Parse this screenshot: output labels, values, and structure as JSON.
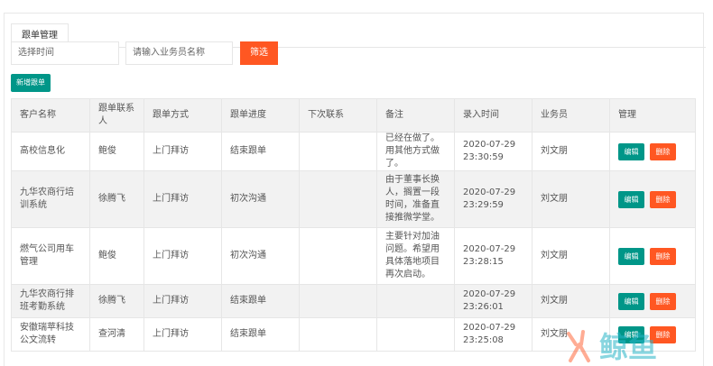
{
  "tabs": [
    {
      "label": "跟单管理"
    }
  ],
  "filters": {
    "time_placeholder": "选择时间",
    "name_placeholder": "请输入业务员名称",
    "filter_label": "筛选"
  },
  "toolbar": {
    "add_label": "新增跟单"
  },
  "table": {
    "columns": [
      "客户名称",
      "跟单联系人",
      "跟单方式",
      "跟单进度",
      "下次联系",
      "备注",
      "录入时间",
      "业务员",
      "管理"
    ],
    "rows": [
      {
        "customer": "高校信息化",
        "contact": "鲍俊",
        "method": "上门拜访",
        "progress": "结束跟单",
        "next": "",
        "note": "已经在做了。用其他方式做了。",
        "date": "2020-07-29",
        "time": "23:30:59",
        "sales": "刘文朋"
      },
      {
        "customer": "九华农商行培训系统",
        "contact": "徐腾飞",
        "method": "上门拜访",
        "progress": "初次沟通",
        "next": "",
        "note": "由于董事长换人，搁置一段时间，准备直接推微学堂。",
        "date": "2020-07-29",
        "time": "23:29:59",
        "sales": "刘文朋"
      },
      {
        "customer": "燃气公司用车管理",
        "contact": "鲍俊",
        "method": "上门拜访",
        "progress": "初次沟通",
        "next": "",
        "note": "主要针对加油问题。希望用具体落地项目再次启动。",
        "date": "2020-07-29",
        "time": "23:28:15",
        "sales": "刘文朋"
      },
      {
        "customer": "九华农商行排班考勤系统",
        "contact": "徐腾飞",
        "method": "上门拜访",
        "progress": "结束跟单",
        "next": "",
        "note": "",
        "date": "2020-07-29",
        "time": "23:26:01",
        "sales": "刘文朋"
      },
      {
        "customer": "安徽瑞苹科技公文流转",
        "contact": "查河清",
        "method": "上门拜访",
        "progress": "结束跟单",
        "next": "",
        "note": "",
        "date": "2020-07-29",
        "time": "23:25:08",
        "sales": "刘文朋"
      }
    ],
    "edit_label": "编辑",
    "delete_label": "删除"
  },
  "watermark": {
    "text": "鲸鱼"
  },
  "colors": {
    "primary": "#009688",
    "danger": "#ff5722",
    "link": "#1e9fff"
  }
}
